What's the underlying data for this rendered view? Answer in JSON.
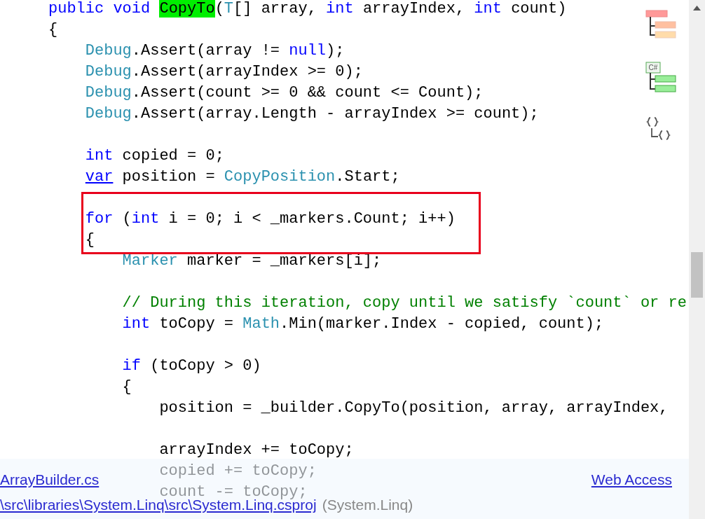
{
  "code_lines": [
    {
      "kind": "code",
      "tokens": [
        {
          "t": "public void ",
          "kind": "keyword"
        },
        {
          "t": "CopyTo",
          "kind": "match"
        },
        {
          "t": "(",
          "kind": "plain"
        },
        {
          "t": "T",
          "kind": "type"
        },
        {
          "t": "[] array, ",
          "kind": "plain"
        },
        {
          "t": "int",
          "kind": "keyword"
        },
        {
          "t": " arrayIndex, ",
          "kind": "plain"
        },
        {
          "t": "int",
          "kind": "keyword"
        },
        {
          "t": " count)",
          "kind": "plain"
        }
      ]
    },
    {
      "kind": "code",
      "tokens": [
        {
          "t": "{",
          "kind": "plain"
        }
      ],
      "children": [
        {
          "kind": "code",
          "tokens": [
            {
              "t": "Debug",
              "kind": "type"
            },
            {
              "t": ".Assert(array != ",
              "kind": "plain"
            },
            {
              "t": "null",
              "kind": "keyword"
            },
            {
              "t": ");",
              "kind": "plain"
            }
          ]
        },
        {
          "kind": "code",
          "tokens": [
            {
              "t": "Debug",
              "kind": "type"
            },
            {
              "t": ".Assert(arrayIndex >= 0);",
              "kind": "plain"
            }
          ]
        },
        {
          "kind": "code",
          "tokens": [
            {
              "t": "Debug",
              "kind": "type"
            },
            {
              "t": ".Assert(count >= 0 && count <= Count);",
              "kind": "plain"
            }
          ]
        },
        {
          "kind": "code",
          "tokens": [
            {
              "t": "Debug",
              "kind": "type"
            },
            {
              "t": ".Assert(array.Length - arrayIndex >= count);",
              "kind": "plain"
            }
          ]
        },
        {
          "kind": "blank"
        },
        {
          "kind": "code",
          "tokens": [
            {
              "t": "int",
              "kind": "keyword"
            },
            {
              "t": " copied = 0;",
              "kind": "plain"
            }
          ]
        },
        {
          "kind": "code",
          "tokens": [
            {
              "t": "var",
              "kind": "keyword-link"
            },
            {
              "t": " position = ",
              "kind": "plain"
            },
            {
              "t": "CopyPosition",
              "kind": "type"
            },
            {
              "t": ".Start;",
              "kind": "plain"
            }
          ]
        },
        {
          "kind": "blank"
        },
        {
          "kind": "frame",
          "lines": [
            {
              "kind": "code",
              "tokens": [
                {
                  "t": "for",
                  "kind": "keyword"
                },
                {
                  "t": " (",
                  "kind": "plain"
                },
                {
                  "t": "int",
                  "kind": "keyword"
                },
                {
                  "t": " i = 0; i < _markers.Count; i++)",
                  "kind": "plain"
                }
              ]
            },
            {
              "kind": "code",
              "tokens": [
                {
                  "t": "{",
                  "kind": "plain"
                }
              ],
              "children": [
                {
                  "kind": "code",
                  "tokens": [
                    {
                      "t": "Marker",
                      "kind": "type"
                    },
                    {
                      "t": " marker = _markers[i];",
                      "kind": "plain"
                    }
                  ]
                },
                {
                  "kind": "blank"
                },
                {
                  "kind": "code",
                  "tokens": [
                    {
                      "t": "// During this iteration, copy until we satisfy `count` or re",
                      "kind": "comment"
                    }
                  ]
                },
                {
                  "kind": "code",
                  "tokens": [
                    {
                      "t": "int",
                      "kind": "keyword"
                    },
                    {
                      "t": " toCopy = ",
                      "kind": "plain"
                    },
                    {
                      "t": "Math",
                      "kind": "type"
                    },
                    {
                      "t": ".Min(marker.Index - copied, count);",
                      "kind": "plain"
                    }
                  ]
                },
                {
                  "kind": "blank"
                },
                {
                  "kind": "code",
                  "tokens": [
                    {
                      "t": "if",
                      "kind": "keyword"
                    },
                    {
                      "t": " (toCopy > 0)",
                      "kind": "plain"
                    }
                  ]
                },
                {
                  "kind": "code",
                  "tokens": [
                    {
                      "t": "{",
                      "kind": "plain"
                    }
                  ],
                  "children": [
                    {
                      "kind": "code",
                      "tokens": [
                        {
                          "t": "position = _builder.CopyTo(position, array, arrayIndex,",
                          "kind": "plain"
                        }
                      ]
                    },
                    {
                      "kind": "blank"
                    },
                    {
                      "kind": "code",
                      "tokens": [
                        {
                          "t": "arrayIndex += toCopy;",
                          "kind": "plain"
                        }
                      ]
                    },
                    {
                      "kind": "code",
                      "tokens": [
                        {
                          "t": "copied += toCopy;",
                          "kind": "plain"
                        }
                      ]
                    },
                    {
                      "kind": "code",
                      "tokens": [
                        {
                          "t": "count -= toCopy;",
                          "kind": "plain"
                        }
                      ]
                    }
                  ]
                }
              ]
            }
          ]
        }
      ]
    }
  ],
  "margin_icons": [
    {
      "kind": "class-tree"
    },
    {
      "kind": "namespace-tree",
      "label": "C#"
    },
    {
      "kind": "braces"
    }
  ],
  "info_panel": {
    "file_link": "ArrayBuilder.cs",
    "web_link": "Web Access",
    "project_link": "\\src\\libraries\\System.Linq\\src\\System.Linq.csproj",
    "project_name": "(System.Linq)"
  }
}
